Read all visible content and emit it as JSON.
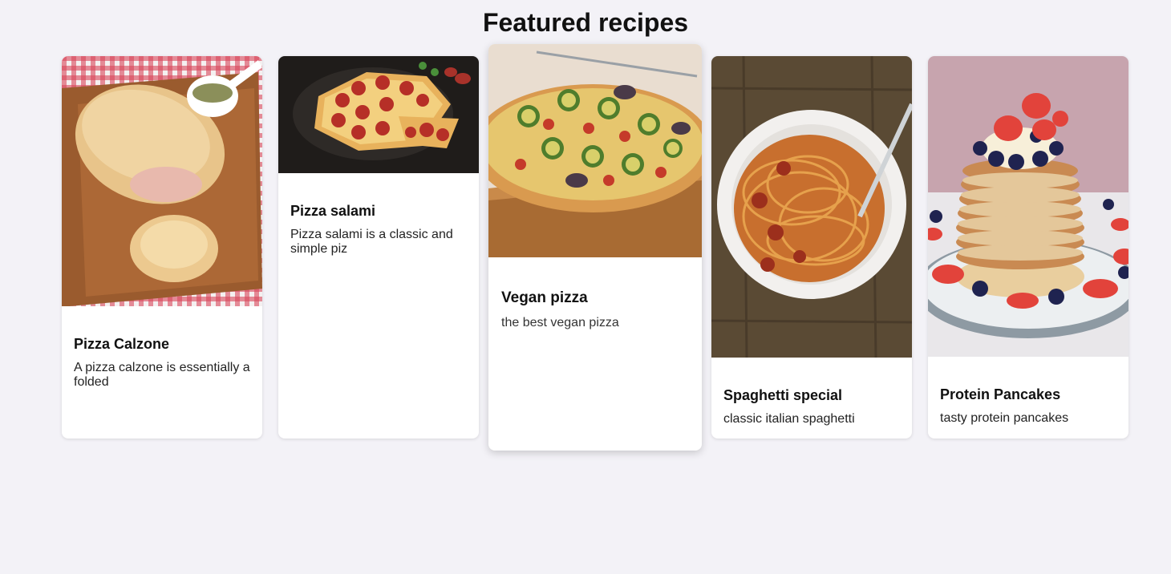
{
  "page": {
    "title": "Featured recipes"
  },
  "recipes": [
    {
      "title": "Pizza Calzone",
      "description": "A pizza calzone is essentially a folded",
      "image_icon": "calzone-photo"
    },
    {
      "title": "Pizza salami",
      "description": "Pizza salami is a classic and simple piz",
      "image_icon": "salami-pizza-photo"
    },
    {
      "title": "Vegan pizza",
      "description": "the best vegan pizza",
      "image_icon": "vegan-pizza-photo"
    },
    {
      "title": "Spaghetti special",
      "description": "classic italian spaghetti",
      "image_icon": "spaghetti-photo"
    },
    {
      "title": "Protein Pancakes",
      "description": "tasty protein pancakes",
      "image_icon": "pancakes-photo"
    }
  ],
  "colors": {
    "background": "#f3f2f7",
    "card": "#ffffff",
    "text": "#111111"
  }
}
